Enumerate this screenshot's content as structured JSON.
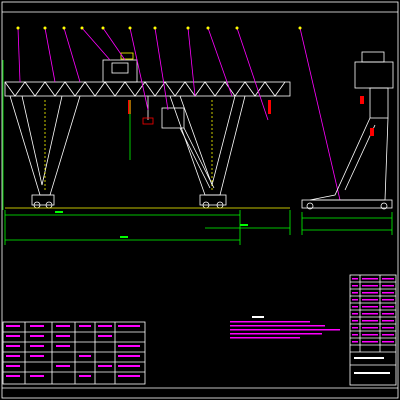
{
  "colors": {
    "background": "#000000",
    "frame": "#ffffff",
    "steel": "#ffffff",
    "structure": "#ffff00",
    "dimension": "#00ff00",
    "leader": "#ff00ff",
    "table_text": "#ff00ff",
    "note_text": "#ff00ff",
    "accent": "#ff0000",
    "cyan": "#00ffff"
  },
  "drawing": {
    "title": "",
    "notes_heading": "",
    "numbers_visible": false
  }
}
